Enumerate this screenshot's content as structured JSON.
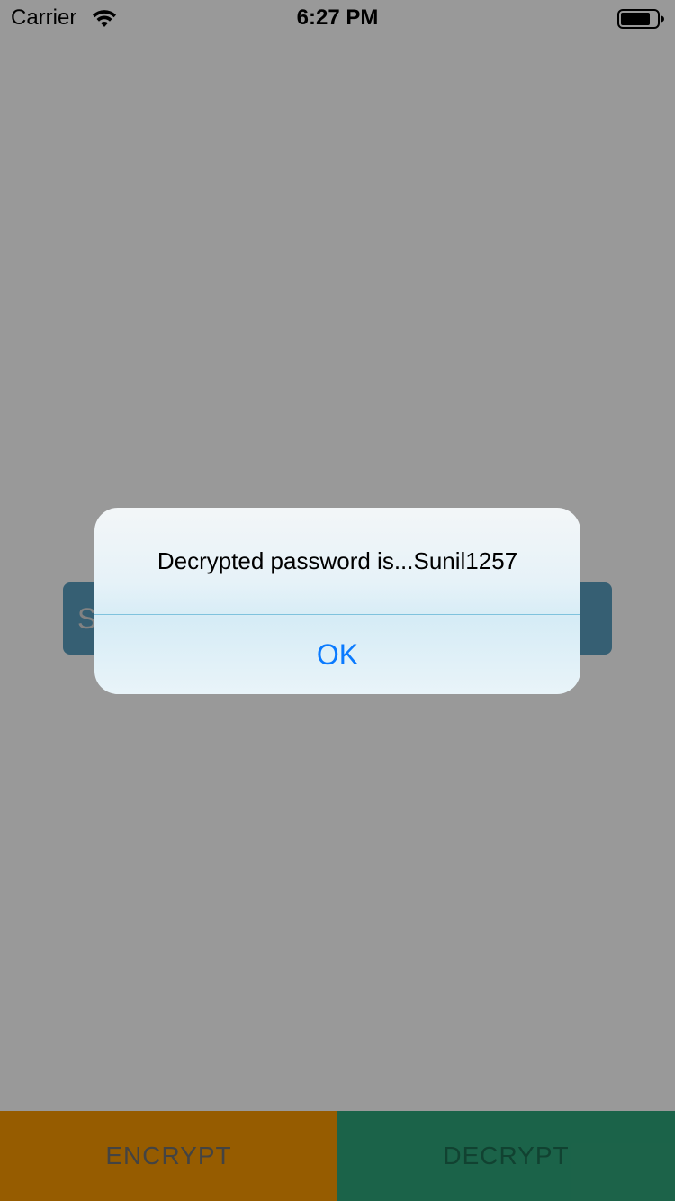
{
  "status_bar": {
    "carrier": "Carrier",
    "time": "6:27 PM",
    "wifi_icon": "wifi-icon",
    "battery_icon": "battery-icon"
  },
  "app": {
    "secret_field_visible_text": "S",
    "encrypt_label": "ENCRYPT",
    "decrypt_label": "DECRYPT",
    "colors": {
      "encrypt_bg": "#fa9a00",
      "decrypt_bg": "#2ea57a",
      "field_bg": "#5a9fc0"
    }
  },
  "alert": {
    "message": "Decrypted password is...Sunil1257",
    "ok_label": "OK",
    "ok_color": "#0a7aff"
  }
}
